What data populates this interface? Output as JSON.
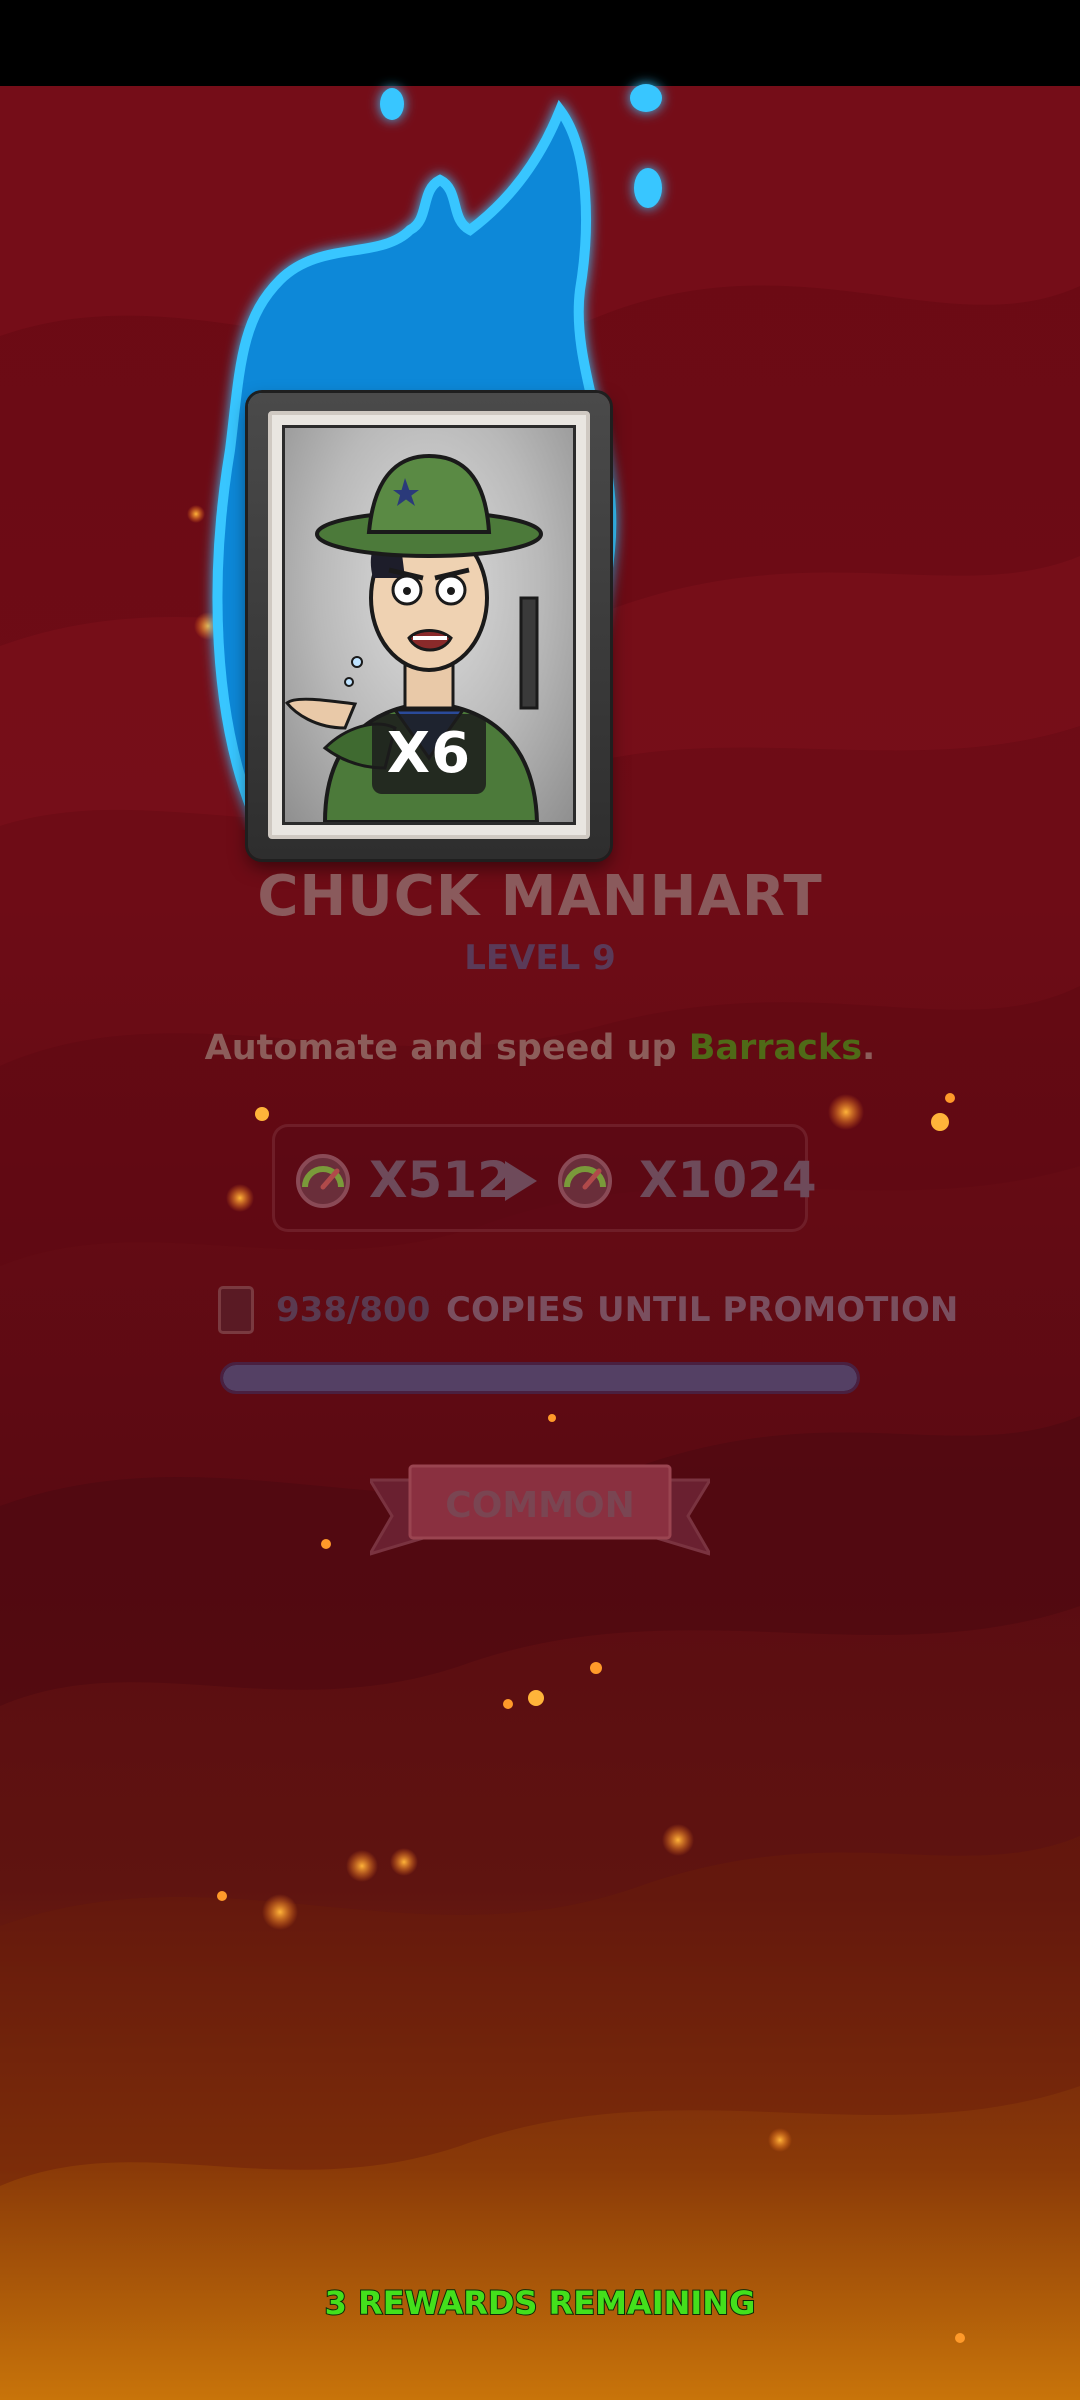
{
  "card": {
    "multiplier": "X6",
    "name": "CHUCK MANHART",
    "level": "LEVEL 9"
  },
  "description": {
    "prefix": "Automate and speed up ",
    "highlight": "Barracks",
    "suffix": "."
  },
  "upgrade": {
    "current_multiplier": "X512",
    "next_multiplier": "X1024",
    "icon": "speed-gauge-icon"
  },
  "promotion": {
    "copies_count": "938/800",
    "copies_label": "COPIES UNTIL PROMOTION",
    "progress": 1.0
  },
  "rarity": {
    "label": "COMMON"
  },
  "footer": {
    "rewards_remaining": "3 REWARDS REMAINING"
  },
  "colors": {
    "background_top": "#7a0f19",
    "background_bottom": "#c5710a",
    "flame": "#2ab5f0",
    "highlight_green": "#4f6a17",
    "rewards_green": "#43e01c"
  }
}
